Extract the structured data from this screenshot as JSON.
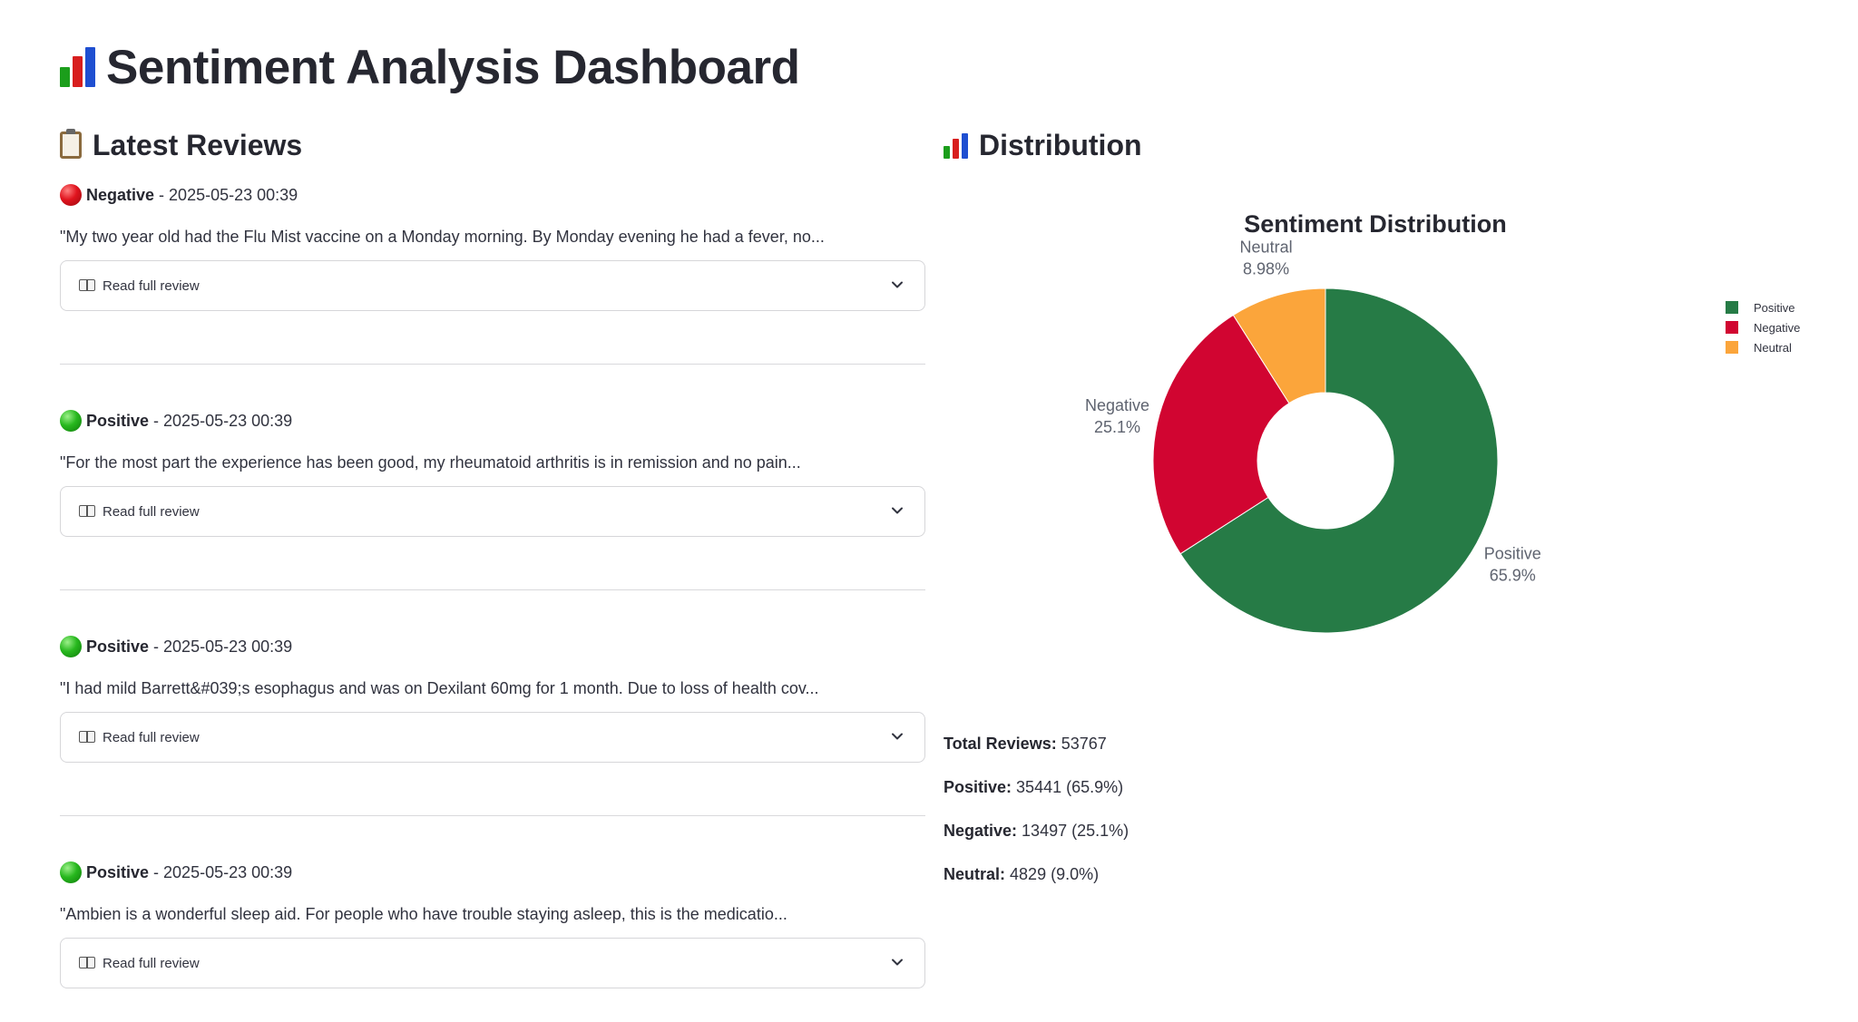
{
  "app": {
    "title": "Sentiment Analysis Dashboard"
  },
  "reviews_section": {
    "title": "Latest Reviews",
    "icon": "clipboard-icon",
    "expander_label": "Read full review",
    "items": [
      {
        "sentiment": "Negative",
        "date": "2025-05-23 00:39",
        "text": "\"My two year old had the Flu Mist vaccine on a Monday morning.  By Monday evening he had a fever, no..."
      },
      {
        "sentiment": "Positive",
        "date": "2025-05-23 00:39",
        "text": "\"For the most part the experience has been good, my rheumatoid arthritis is in remission and no pain..."
      },
      {
        "sentiment": "Positive",
        "date": "2025-05-23 00:39",
        "text": "\"I had mild Barrett&#039;s esophagus and was on Dexilant 60mg for 1 month. Due to loss of health cov..."
      },
      {
        "sentiment": "Positive",
        "date": "2025-05-23 00:39",
        "text": "\"Ambien is a wonderful sleep aid.  For people who have trouble staying asleep, this is the medicatio..."
      }
    ]
  },
  "distribution_section": {
    "title": "Distribution",
    "icon": "bar-chart-icon"
  },
  "chart_data": {
    "type": "pie",
    "donut": true,
    "title": "Sentiment Distribution",
    "legend_position": "top-right",
    "labels": [
      "Positive",
      "Negative",
      "Neutral"
    ],
    "values": [
      35441,
      13497,
      4829
    ],
    "percent_labels": [
      "65.9%",
      "25.1%",
      "8.98%"
    ],
    "colors": [
      "#267b46",
      "#d10531",
      "#fba53b"
    ]
  },
  "stats": {
    "total_label": "Total Reviews:",
    "total_value": "53767",
    "positive_label": "Positive:",
    "positive_value": "35441 (65.9%)",
    "negative_label": "Negative:",
    "negative_value": "13497 (25.1%)",
    "neutral_label": "Neutral:",
    "neutral_value": "4829 (9.0%)"
  },
  "colors": {
    "positive": "#267b46",
    "negative": "#d10531",
    "neutral": "#fba53b",
    "text": "#31333f"
  }
}
